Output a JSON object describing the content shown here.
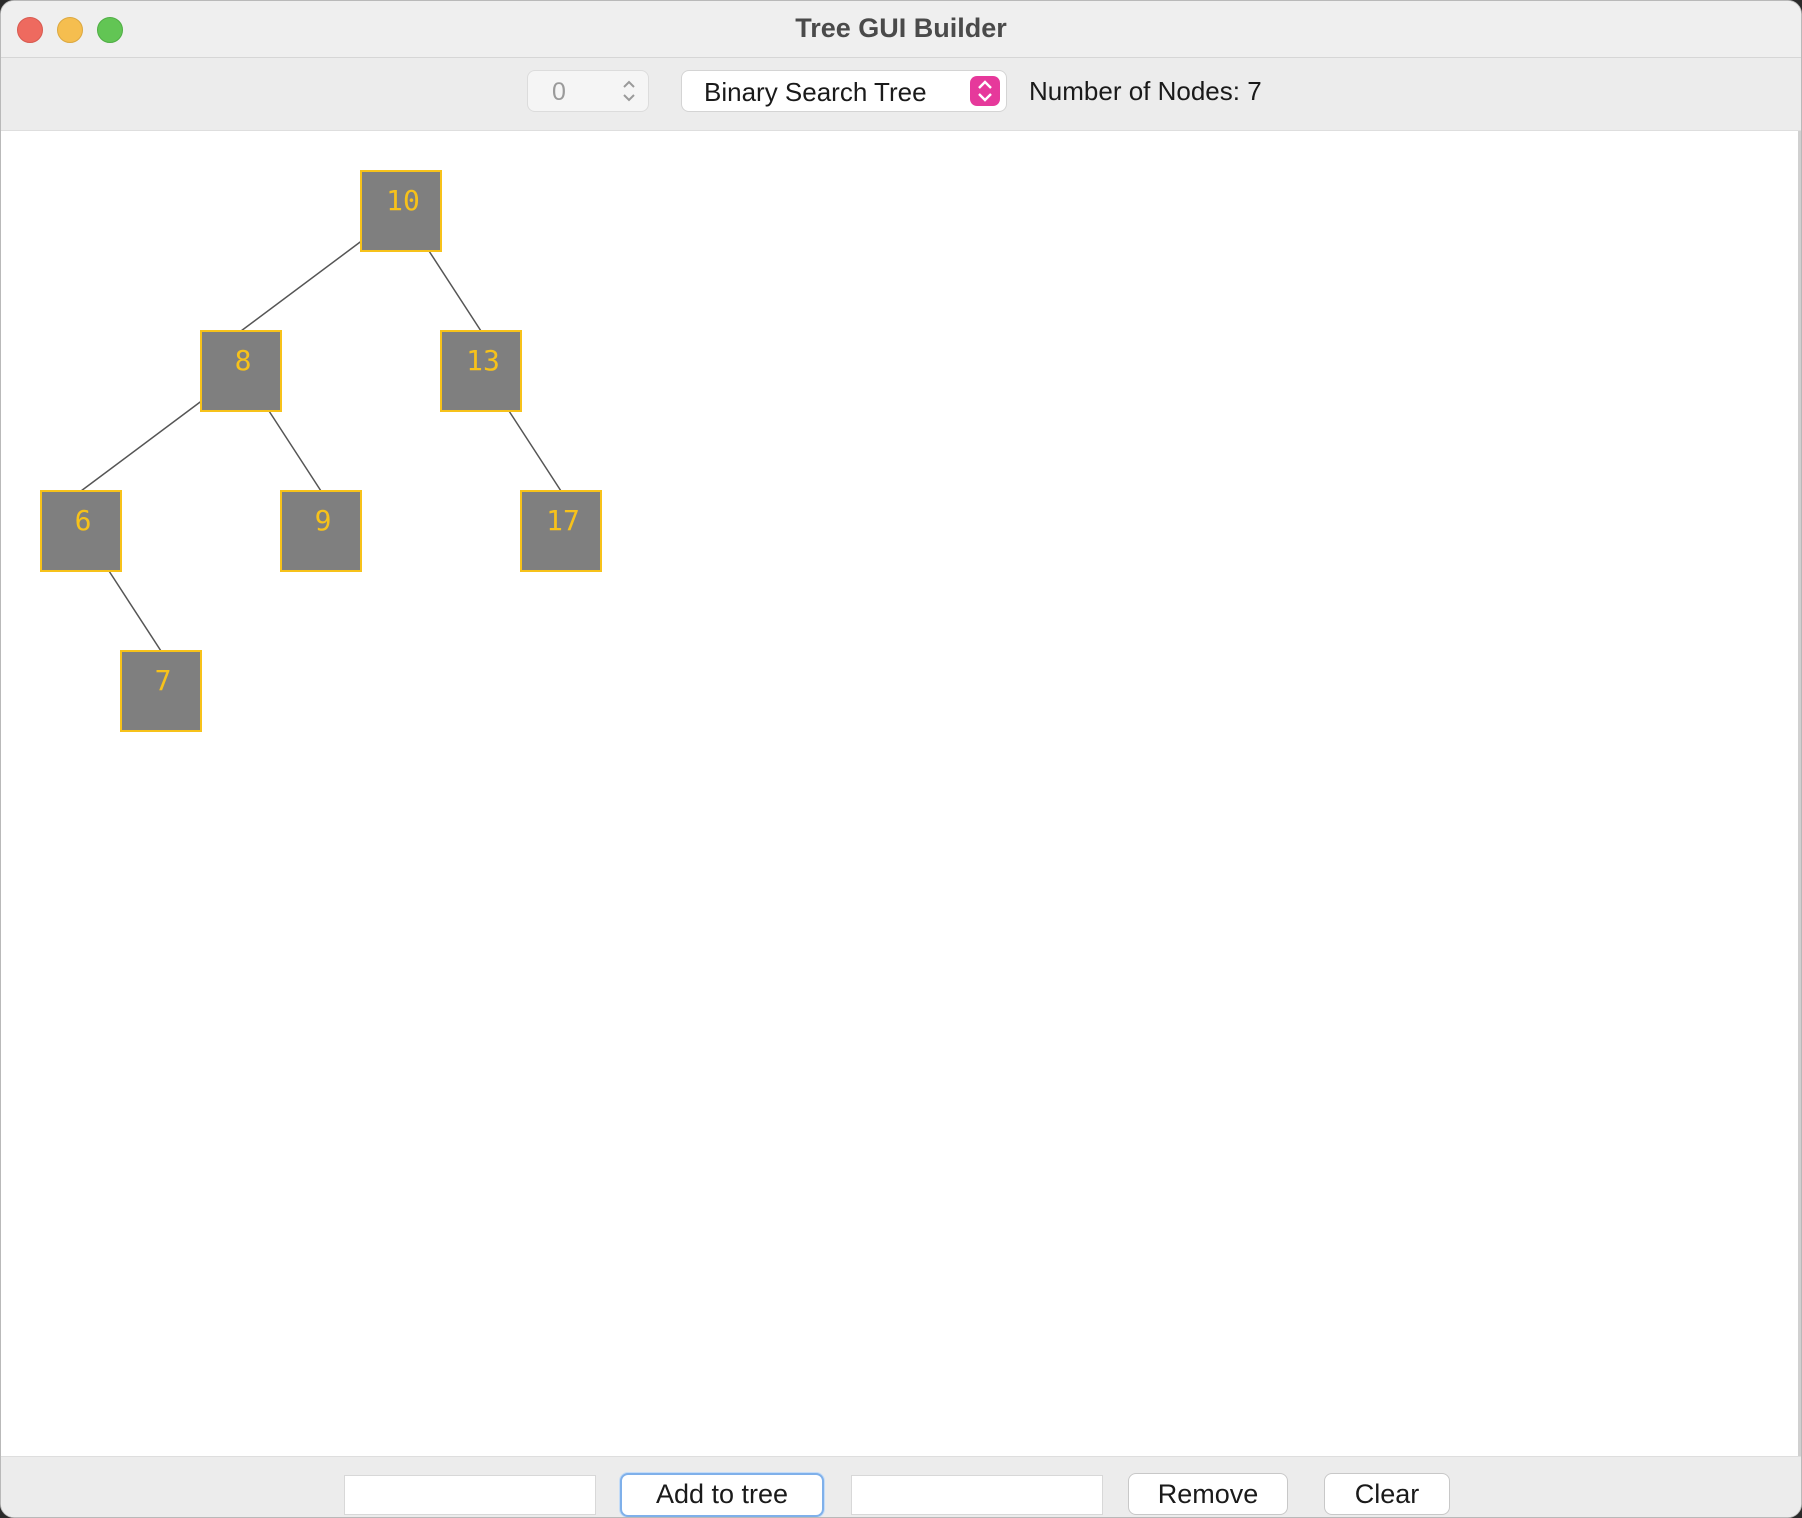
{
  "window": {
    "title": "Tree GUI Builder"
  },
  "toolbar": {
    "spinner_value": "0",
    "tree_type": "Binary Search Tree",
    "node_count_text": "Number of Nodes: 7"
  },
  "tree": {
    "nodes": [
      {
        "id": "n10",
        "value": "10",
        "depth": 0,
        "slot": 4
      },
      {
        "id": "n8",
        "value": "8",
        "depth": 1,
        "slot": 2
      },
      {
        "id": "n13",
        "value": "13",
        "depth": 1,
        "slot": 5
      },
      {
        "id": "n6",
        "value": "6",
        "depth": 2,
        "slot": 0
      },
      {
        "id": "n9",
        "value": "9",
        "depth": 2,
        "slot": 3
      },
      {
        "id": "n17",
        "value": "17",
        "depth": 2,
        "slot": 6
      },
      {
        "id": "n7",
        "value": "7",
        "depth": 3,
        "slot": 1
      }
    ],
    "edges": [
      [
        "n10",
        "n8"
      ],
      [
        "n10",
        "n13"
      ],
      [
        "n8",
        "n6"
      ],
      [
        "n8",
        "n9"
      ],
      [
        "n13",
        "n17"
      ],
      [
        "n6",
        "n7"
      ]
    ],
    "colors": {
      "fill": "#7f7f7f",
      "border": "#f7c21a",
      "text": "#f7c21a",
      "edge": "#555555"
    }
  },
  "bottom": {
    "add_input_value": "",
    "add_button": "Add to tree",
    "remove_input_value": "",
    "remove_button": "Remove",
    "clear_button": "Clear"
  }
}
